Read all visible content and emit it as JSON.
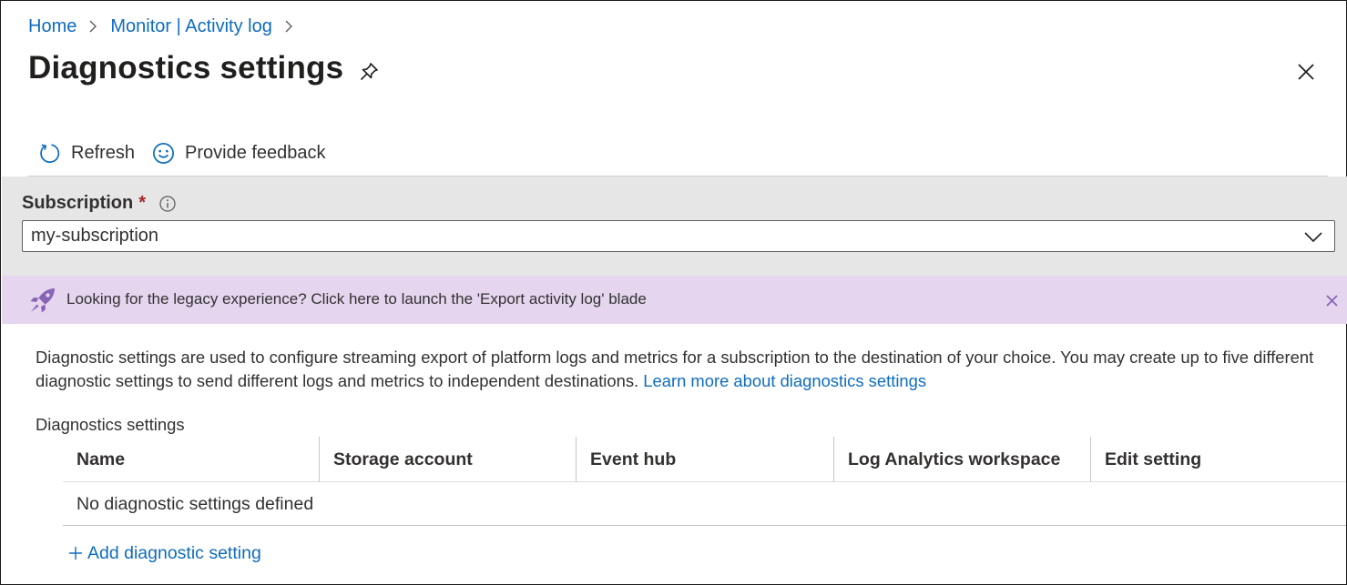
{
  "breadcrumb": {
    "items": [
      "Home",
      "Monitor | Activity log"
    ]
  },
  "header": {
    "title": "Diagnostics settings"
  },
  "toolbar": {
    "refresh_label": "Refresh",
    "feedback_label": "Provide feedback"
  },
  "subscription": {
    "label": "Subscription",
    "required_marker": "*",
    "selected_value": "my-subscription"
  },
  "banner": {
    "text": "Looking for the legacy experience? Click here to launch the 'Export activity log' blade"
  },
  "description": {
    "text": "Diagnostic settings are used to configure streaming export of platform logs and metrics for a subscription to the destination of your choice. You may create up to five different diagnostic settings to send different logs and metrics to independent destinations.",
    "link_text": "Learn more about diagnostics settings"
  },
  "table": {
    "section_label": "Diagnostics settings",
    "columns": [
      "Name",
      "Storage account",
      "Event hub",
      "Log Analytics workspace",
      "Edit setting"
    ],
    "empty_message": "No diagnostic settings defined"
  },
  "actions": {
    "add_label": "Add diagnostic setting"
  },
  "colors": {
    "link": "#0f6cbd",
    "banner_background": "#e5d5ef",
    "banner_accent": "#8764b8",
    "panel_background": "#e6e6e6",
    "required": "#a4262c"
  },
  "icons": [
    "chevron-right-icon",
    "pin-icon",
    "close-icon",
    "refresh-icon",
    "smiley-icon",
    "info-icon",
    "chevron-down-icon",
    "rocket-icon",
    "dismiss-icon",
    "plus-icon"
  ]
}
